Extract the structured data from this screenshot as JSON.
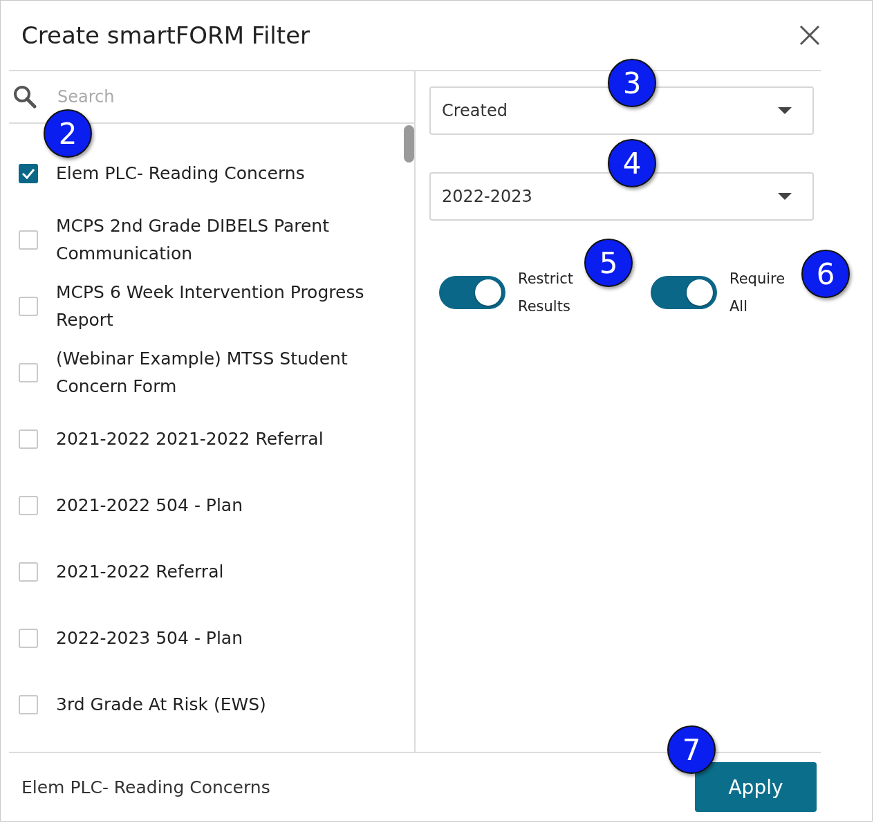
{
  "dialog": {
    "title": "Create smartFORM Filter"
  },
  "search": {
    "placeholder": "Search"
  },
  "forms": [
    {
      "label": "Elem PLC- Reading Concerns",
      "checked": true
    },
    {
      "label": "MCPS 2nd Grade DIBELS Parent Communication",
      "checked": false
    },
    {
      "label": "MCPS 6 Week Intervention Progress Report",
      "checked": false
    },
    {
      "label": "(Webinar Example) MTSS Student Concern Form",
      "checked": false
    },
    {
      "label": "2021-2022 2021-2022 Referral",
      "checked": false
    },
    {
      "label": "2021-2022 504 - Plan",
      "checked": false
    },
    {
      "label": "2021-2022 Referral",
      "checked": false
    },
    {
      "label": "2022-2023 504 - Plan",
      "checked": false
    },
    {
      "label": "3rd Grade At Risk (EWS)",
      "checked": false
    }
  ],
  "date_field": {
    "value": "Created"
  },
  "year_field": {
    "value": "2022-2023"
  },
  "toggles": [
    {
      "label": "Restrict Results",
      "on": true
    },
    {
      "label": "Require All",
      "on": true
    }
  ],
  "footer": {
    "selection": "Elem PLC- Reading Concerns",
    "button": "Apply"
  },
  "callouts": [
    "2",
    "3",
    "4",
    "5",
    "6",
    "7"
  ]
}
